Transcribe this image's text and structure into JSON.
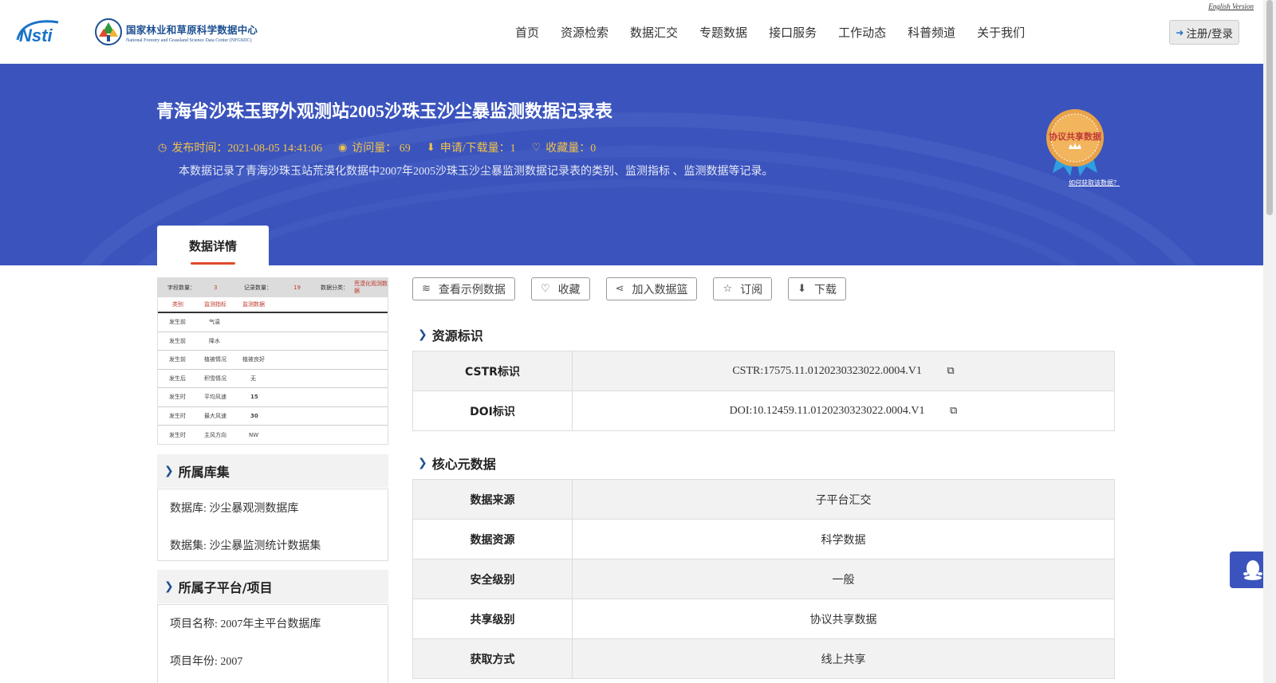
{
  "header": {
    "english_link": "English Version",
    "logo_cn": "国家林业和草原科学数据中心",
    "logo_en": "National Forestry and Grassland Science Data Center (NFGSDC)",
    "nav": [
      "首页",
      "资源检索",
      "数据汇交",
      "专题数据",
      "接口服务",
      "工作动态",
      "科普频道",
      "关于我们"
    ],
    "login": "注册/登录"
  },
  "banner": {
    "title": "青海省沙珠玉野外观测站2005沙珠玉沙尘暴监测数据记录表",
    "publish_time": "发布时间：2021-08-05 14:41:06",
    "visits": "访问量： 69",
    "downloads": "申请/下载量：1",
    "favorites": "收藏量：0",
    "description": "本数据记录了青海沙珠玉站荒漠化数据中2007年2005沙珠玉沙尘暴监测数据记录表的类别、监测指标 、监测数据等记录。",
    "badge_text": "协议共享数据",
    "badge_link": "如何获取该数据？",
    "tab": "数据详情"
  },
  "thumbnail": {
    "header": [
      "字段数量：",
      "3",
      "记录数量：",
      "19",
      "数据分类：",
      "荒漠化观测数据"
    ],
    "columns": [
      "类别",
      "监测指标",
      "监测数据"
    ],
    "rows": [
      [
        "发生前",
        "气温",
        ""
      ],
      [
        "发生前",
        "降水",
        ""
      ],
      [
        "发生前",
        "植被情况",
        "植被良好"
      ],
      [
        "发生后",
        "积雪情况",
        "无"
      ],
      [
        "发生时",
        "平均风速",
        "15"
      ],
      [
        "发生时",
        "最大风速",
        "30"
      ],
      [
        "发生时",
        "主风方向",
        "NW"
      ]
    ]
  },
  "sidebar": {
    "library_title": "所属库集",
    "database": "数据库: 沙尘暴观测数据库",
    "dataset": "数据集: 沙尘暴监测统计数据集",
    "platform_title": "所属子平台/项目",
    "project_name": "项目名称: 2007年主平台数据库",
    "project_year": "项目年份: 2007"
  },
  "actions": {
    "sample": "查看示例数据",
    "favorite": "收藏",
    "basket": "加入数据篮",
    "subscribe": "订阅",
    "download": "下载"
  },
  "identifiers": {
    "title": "资源标识",
    "cstr_label": "CSTR标识",
    "cstr_value": "CSTR:17575.11.0120230323022.0004.V1",
    "doi_label": "DOI标识",
    "doi_value": "DOI:10.12459.11.0120230323022.0004.V1"
  },
  "core_meta": {
    "title": "核心元数据",
    "rows": [
      {
        "k": "数据来源",
        "v": "子平台汇交"
      },
      {
        "k": "数据资源",
        "v": "科学数据"
      },
      {
        "k": "安全级别",
        "v": "一般"
      },
      {
        "k": "共享级别",
        "v": "协议共享数据"
      },
      {
        "k": "获取方式",
        "v": "线上共享"
      }
    ]
  },
  "colors": {
    "banner": "#3b54bd",
    "meta": "#f2c24a",
    "accent": "#e04a2c"
  }
}
